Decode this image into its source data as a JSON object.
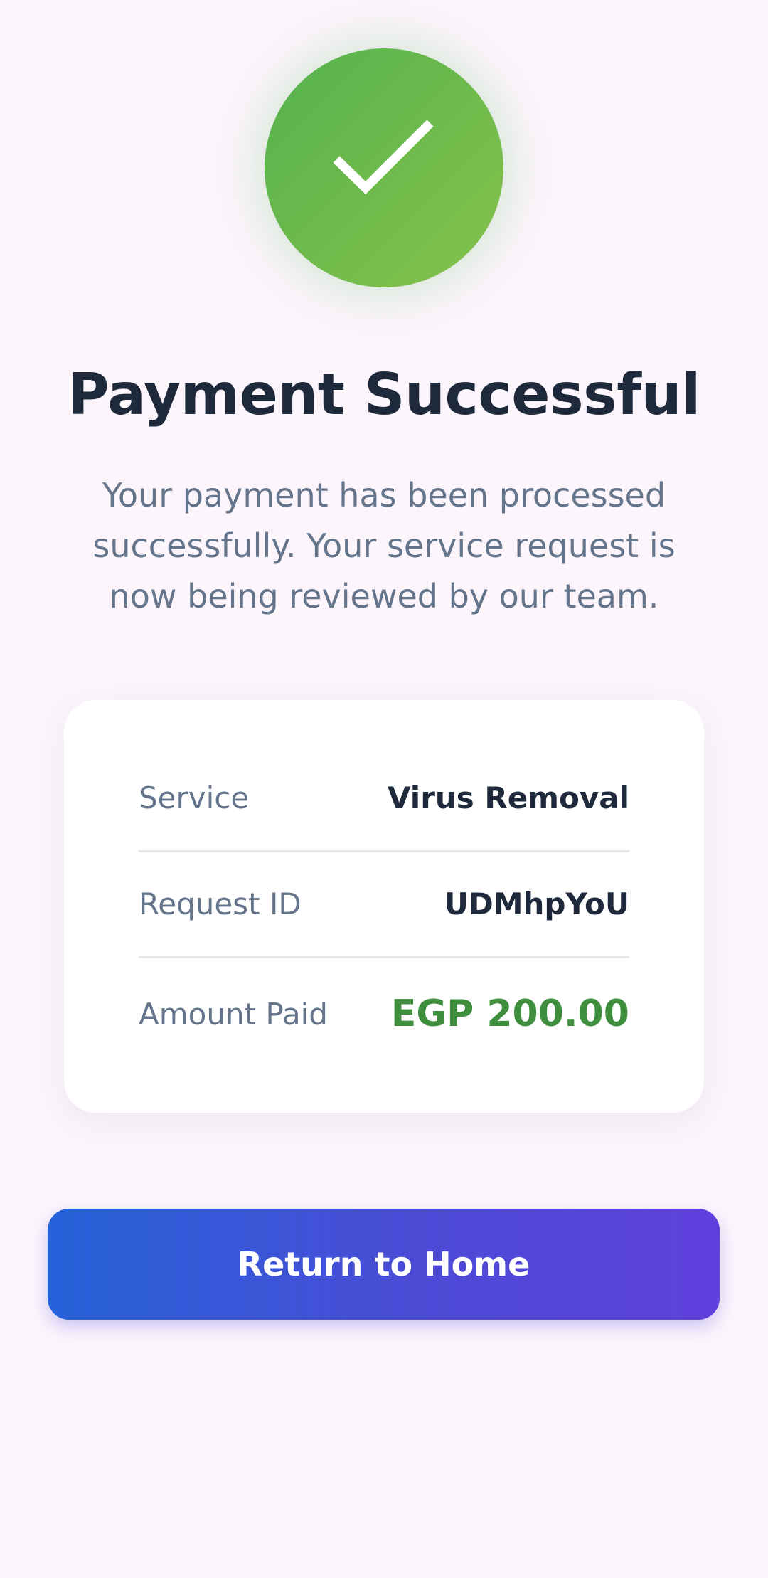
{
  "header": {
    "status_icon": "checkmark-icon",
    "title": "Payment Successful",
    "message": "Your payment has been processed successfully. Your service request is now being reviewed by our team."
  },
  "details": {
    "rows": [
      {
        "label": "Service",
        "value": "Virus Removal"
      },
      {
        "label": "Request ID",
        "value": "UDMhpYoU"
      },
      {
        "label": "Amount Paid",
        "value": "EGP 200.00"
      }
    ]
  },
  "actions": {
    "return_home_label": "Return to Home"
  },
  "colors": {
    "background": "#FCF5FC",
    "success_green_start": "#55B24E",
    "success_green_end": "#86C24B",
    "title_text": "#1E293B",
    "muted_text": "#64748B",
    "amount_green": "#3E8E3E",
    "button_gradient_start": "#2563D9",
    "button_gradient_end": "#6040DC"
  }
}
